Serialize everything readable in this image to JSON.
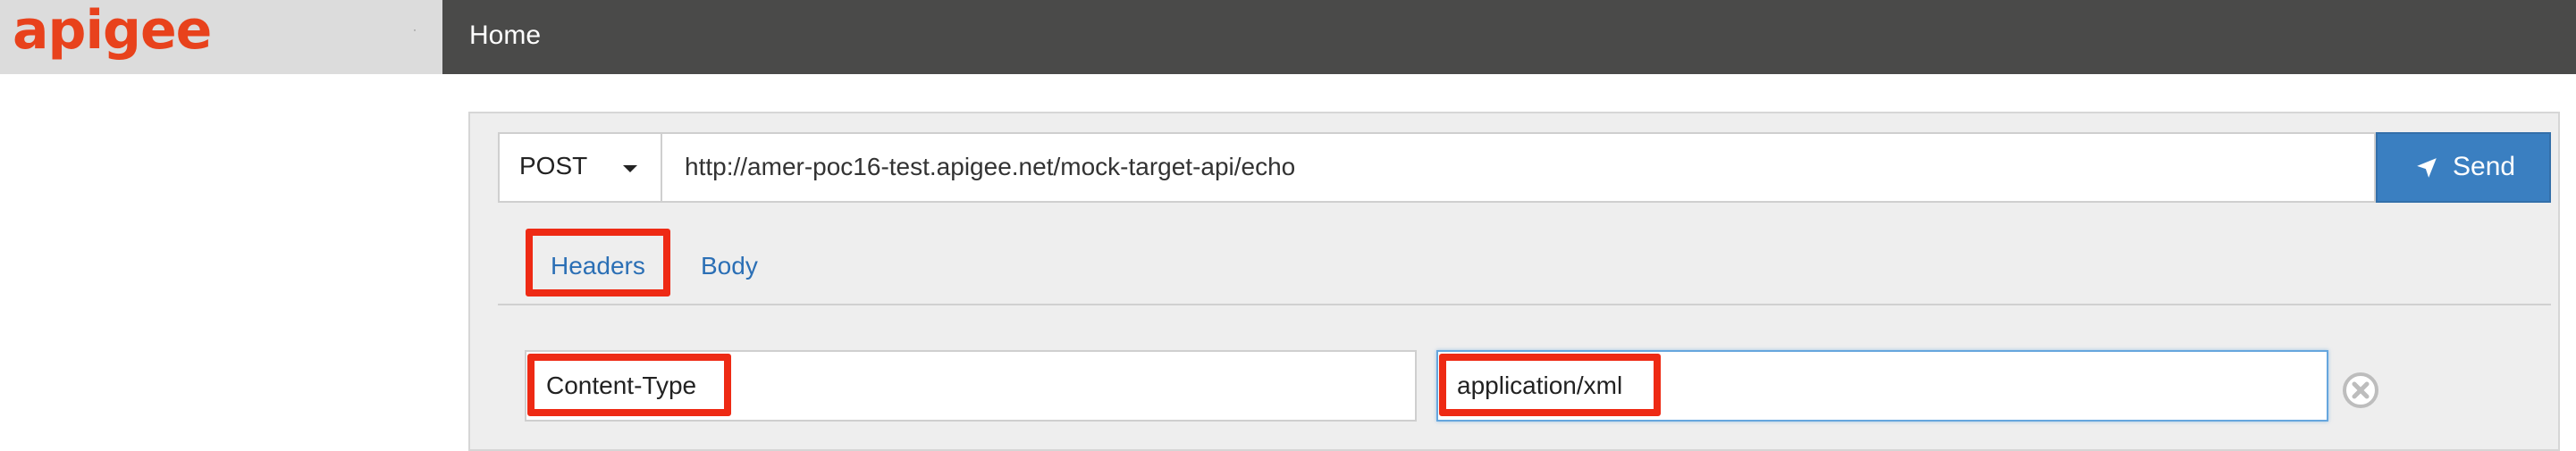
{
  "brand": {
    "logo_text": "apigee"
  },
  "nav": {
    "home_label": "Home"
  },
  "request": {
    "method": "POST",
    "url": "http://amer-poc16-test.apigee.net/mock-target-api/echo",
    "send_label": "Send"
  },
  "tabs": [
    {
      "label": "Headers"
    },
    {
      "label": "Body"
    }
  ],
  "headers": [
    {
      "key": "Content-Type",
      "value": "application/xml"
    }
  ],
  "colors": {
    "brand_orange": "#e8421c",
    "nav_bg": "#4a4a49",
    "send_blue": "#3a7fc1",
    "highlight_red": "#ee2a14",
    "link_blue": "#2b6fb5"
  },
  "icons": {
    "send": "paper-plane-icon",
    "remove": "remove-circle-icon",
    "method_caret": "chevron-down-icon"
  }
}
